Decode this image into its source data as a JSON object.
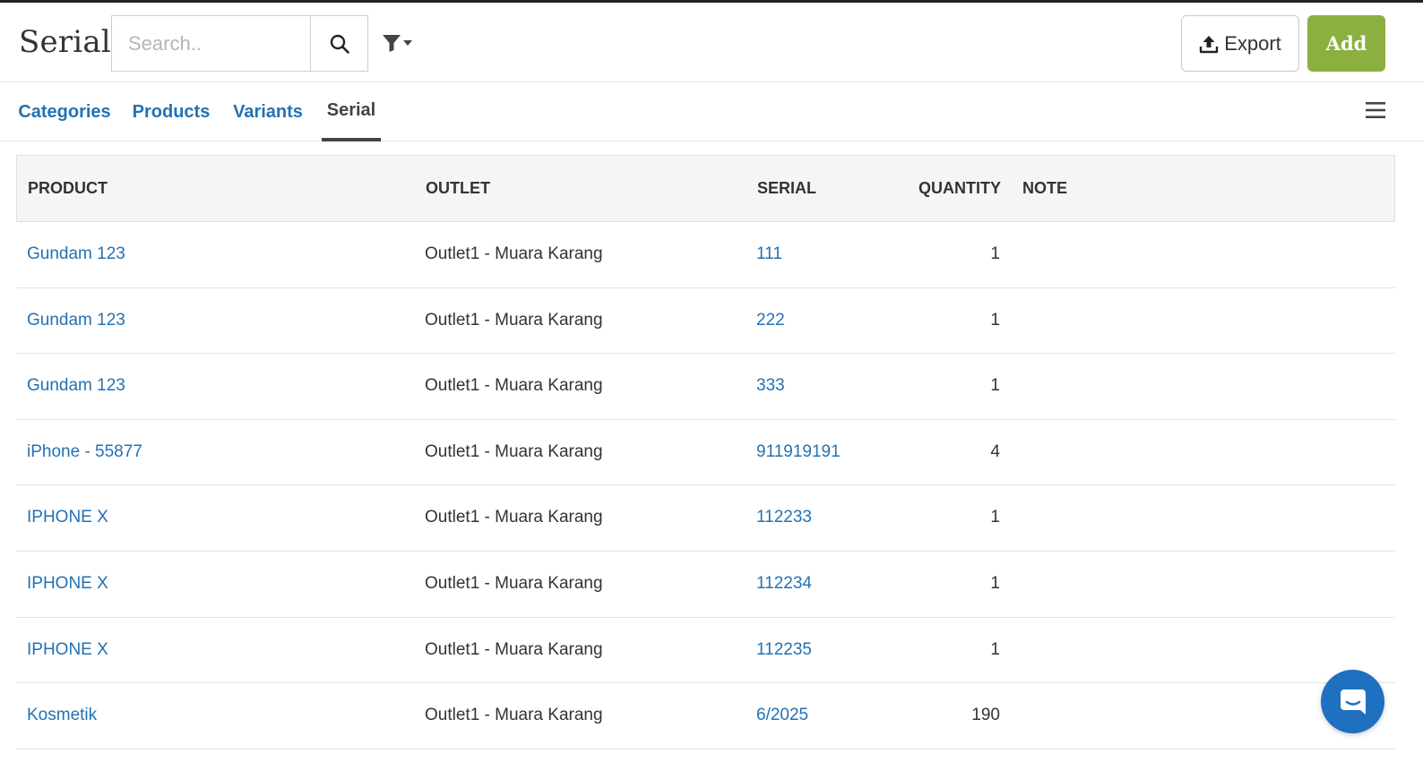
{
  "header": {
    "title": "Serial",
    "search": {
      "placeholder": "Search..",
      "value": ""
    },
    "export_label": "Export",
    "add_label": "Add"
  },
  "tabs": [
    {
      "label": "Categories",
      "active": false
    },
    {
      "label": "Products",
      "active": false
    },
    {
      "label": "Variants",
      "active": false
    },
    {
      "label": "Serial",
      "active": true
    }
  ],
  "table": {
    "columns": [
      "PRODUCT",
      "OUTLET",
      "SERIAL",
      "QUANTITY",
      "NOTE"
    ],
    "rows": [
      {
        "product": "Gundam 123",
        "outlet": "Outlet1 - Muara Karang",
        "serial": "111",
        "quantity": "1",
        "note": ""
      },
      {
        "product": "Gundam 123",
        "outlet": "Outlet1 - Muara Karang",
        "serial": "222",
        "quantity": "1",
        "note": ""
      },
      {
        "product": "Gundam 123",
        "outlet": "Outlet1 - Muara Karang",
        "serial": "333",
        "quantity": "1",
        "note": ""
      },
      {
        "product": "iPhone - 55877",
        "outlet": "Outlet1 - Muara Karang",
        "serial": "911919191",
        "quantity": "4",
        "note": ""
      },
      {
        "product": "IPHONE X",
        "outlet": "Outlet1 - Muara Karang",
        "serial": "112233",
        "quantity": "1",
        "note": ""
      },
      {
        "product": "IPHONE X",
        "outlet": "Outlet1 - Muara Karang",
        "serial": "112234",
        "quantity": "1",
        "note": ""
      },
      {
        "product": "IPHONE X",
        "outlet": "Outlet1 - Muara Karang",
        "serial": "112235",
        "quantity": "1",
        "note": ""
      },
      {
        "product": "Kosmetik",
        "outlet": "Outlet1 - Muara Karang",
        "serial": "6/2025",
        "quantity": "190",
        "note": ""
      }
    ]
  },
  "colors": {
    "link": "#2272b4",
    "add_button": "#8bb03f",
    "chat_button": "#1f70c1",
    "active_tab": "#444444"
  },
  "icons": {
    "search": "search-icon",
    "filter": "filter-dropdown-icon",
    "export": "upload-icon",
    "menu": "hamburger-menu-icon",
    "chat": "chat-icon"
  }
}
